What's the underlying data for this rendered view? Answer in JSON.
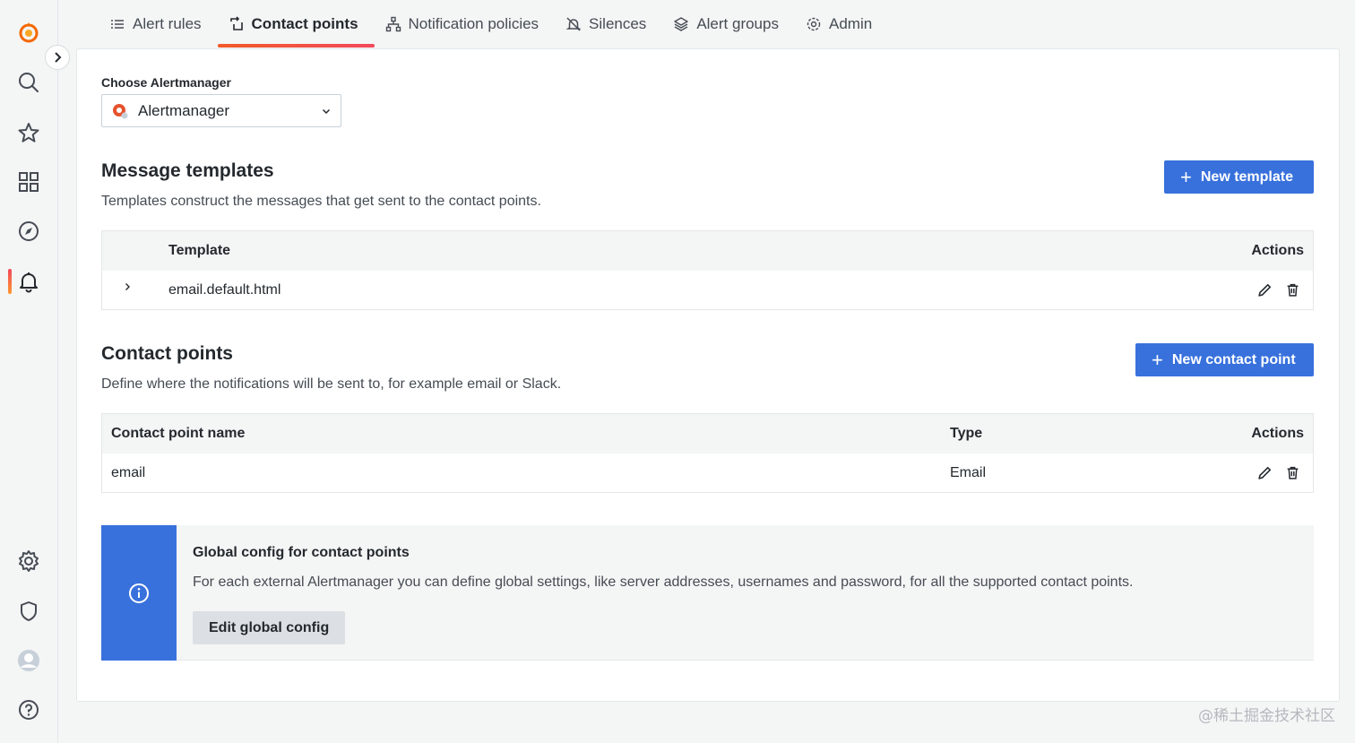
{
  "tabs": [
    {
      "label": "Alert rules",
      "icon": "list-icon"
    },
    {
      "label": "Contact points",
      "icon": "contact-points-icon",
      "active": true
    },
    {
      "label": "Notification policies",
      "icon": "sitemap-icon"
    },
    {
      "label": "Silences",
      "icon": "bell-slash-icon"
    },
    {
      "label": "Alert groups",
      "icon": "layer-group-icon"
    },
    {
      "label": "Admin",
      "icon": "cog-icon"
    }
  ],
  "alertmanager": {
    "label": "Choose Alertmanager",
    "selected": "Alertmanager"
  },
  "templates": {
    "title": "Message templates",
    "description": "Templates construct the messages that get sent to the contact points.",
    "new_button": "New template",
    "headers": {
      "template": "Template",
      "actions": "Actions"
    },
    "rows": [
      {
        "name": "email.default.html"
      }
    ]
  },
  "contact_points": {
    "title": "Contact points",
    "description": "Define where the notifications will be sent to, for example email or Slack.",
    "new_button": "New contact point",
    "headers": {
      "name": "Contact point name",
      "type": "Type",
      "actions": "Actions"
    },
    "rows": [
      {
        "name": "email",
        "type": "Email"
      }
    ]
  },
  "global_config": {
    "title": "Global config for contact points",
    "text": "For each external Alertmanager you can define global settings, like server addresses, usernames and password, for all the supported contact points.",
    "button": "Edit global config"
  },
  "watermark": "@稀土掘金技术社区",
  "colors": {
    "primary": "#3871dc",
    "accent_start": "#f05a28",
    "accent_end": "#f2495c",
    "background": "#f4f5f5"
  }
}
